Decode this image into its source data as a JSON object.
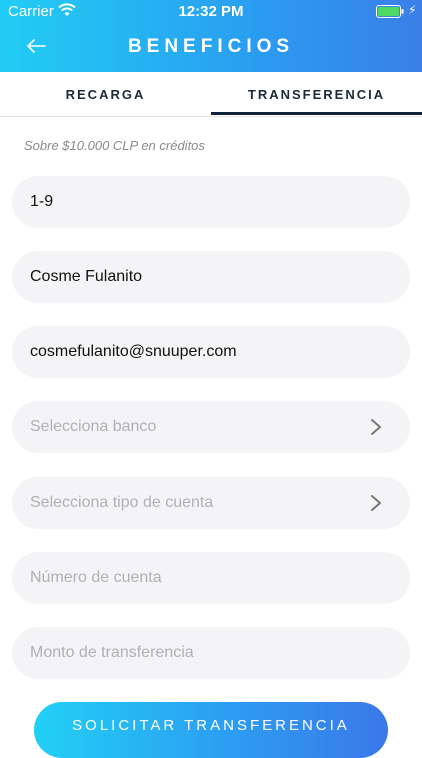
{
  "status_bar": {
    "carrier": "Carrier",
    "time": "12:32 PM"
  },
  "header": {
    "title": "BENEFICIOS",
    "back_icon": "arrow-left-icon"
  },
  "tabs": [
    {
      "label": "RECARGA",
      "selected": false
    },
    {
      "label": "TRANSFERENCIA",
      "selected": true
    }
  ],
  "note": "Sobre $10.000 CLP en créditos",
  "form": {
    "rut": {
      "value": "1-9"
    },
    "name": {
      "value": "Cosme Fulanito"
    },
    "email": {
      "value": "cosmefulanito@snuuper.com"
    },
    "bank": {
      "placeholder": "Selecciona banco"
    },
    "account_type": {
      "placeholder": "Selecciona tipo de cuenta"
    },
    "account_number": {
      "placeholder": "Número de cuenta"
    },
    "amount": {
      "placeholder": "Monto de transferencia"
    }
  },
  "submit_label": "SOLICITAR TRANSFERENCIA",
  "colors": {
    "accent_start": "#21cdf4",
    "accent_end": "#3a7fe8",
    "tab_indicator": "#13233a"
  }
}
